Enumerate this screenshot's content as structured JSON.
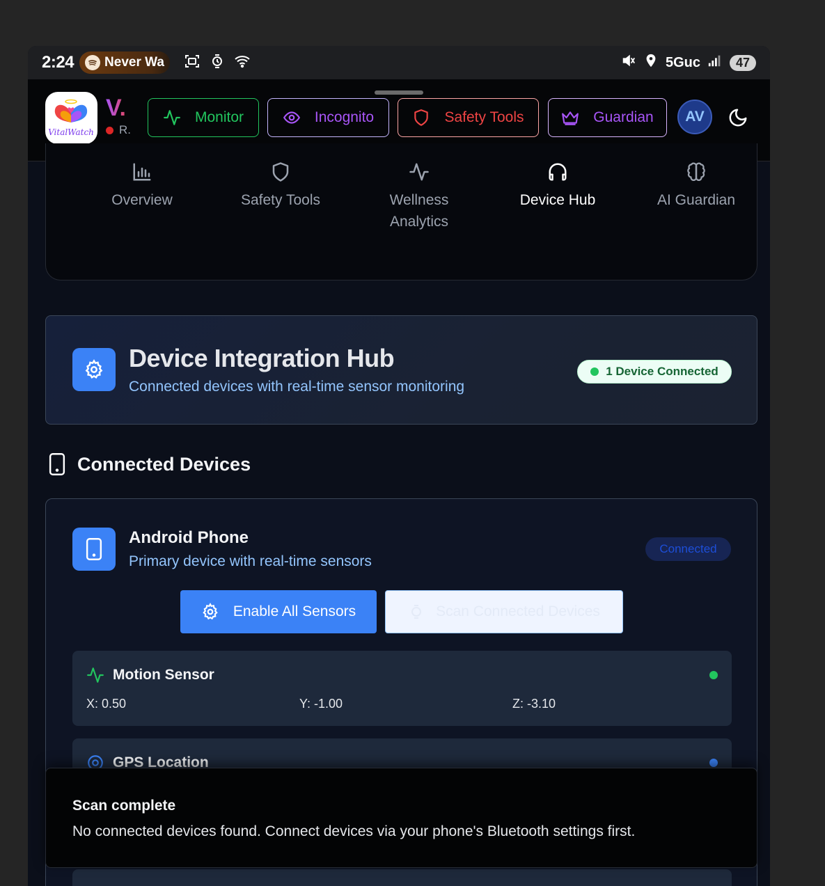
{
  "status_bar": {
    "time": "2:24",
    "media_pill": "Never Wa",
    "network": "5Guc",
    "battery": "47"
  },
  "header": {
    "brand_initial": "V.",
    "brand_sub": "R.",
    "logo_text": "VitalWatch",
    "buttons": {
      "monitor": "Monitor",
      "incognito": "Incognito",
      "safety_tools": "Safety Tools",
      "guardian": "Guardian"
    },
    "avatar_initials": "AV"
  },
  "tabs": [
    {
      "label": "Overview",
      "icon": "bar-chart-icon"
    },
    {
      "label": "Safety Tools",
      "icon": "shield-icon"
    },
    {
      "label": "Wellness Analytics",
      "icon": "activity-icon"
    },
    {
      "label": "Device Hub",
      "icon": "headphones-icon",
      "active": true
    },
    {
      "label": "AI Guardian",
      "icon": "brain-icon"
    }
  ],
  "hero": {
    "title": "Device Integration Hub",
    "subtitle": "Connected devices with real-time sensor monitoring",
    "badge": "1 Device Connected"
  },
  "connected_devices": {
    "heading": "Connected Devices",
    "device": {
      "name": "Android Phone",
      "description": "Primary device with real-time sensors",
      "status": "Connected",
      "enable_button": "Enable All Sensors",
      "scan_button": "Scan Connected Devices"
    },
    "sensors": {
      "motion": {
        "title": "Motion Sensor",
        "x": "X: 0.50",
        "y": "Y: -1.00",
        "z": "Z: -3.10",
        "status_color": "#22c55e"
      },
      "gps": {
        "title": "GPS Location",
        "status_color": "#3b82f6"
      }
    }
  },
  "toast": {
    "title": "Scan complete",
    "message": "No connected devices found. Connect devices via your phone's Bluetooth settings first."
  },
  "colors": {
    "accent_blue": "#3b82f6",
    "monitor_green": "#22c55e",
    "incognito_purple": "#a855f7",
    "safety_red": "#ef4444"
  }
}
